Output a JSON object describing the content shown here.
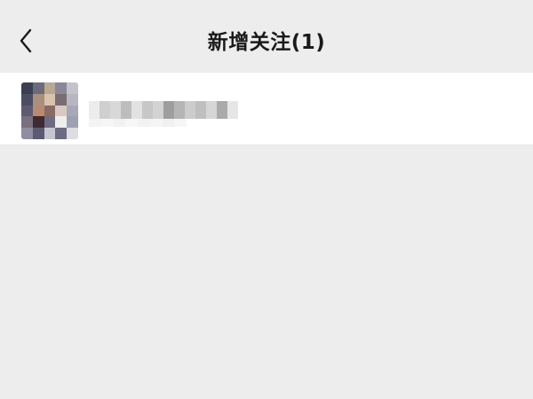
{
  "header": {
    "title": "新增关注(1)",
    "back_icon": "chevron-left-icon"
  },
  "followers": [
    {
      "avatar": "pixelated-photo",
      "name_obscured": true
    }
  ],
  "colors": {
    "background": "#ededed",
    "row_background": "#ffffff",
    "title_text": "#1a1a1a"
  }
}
